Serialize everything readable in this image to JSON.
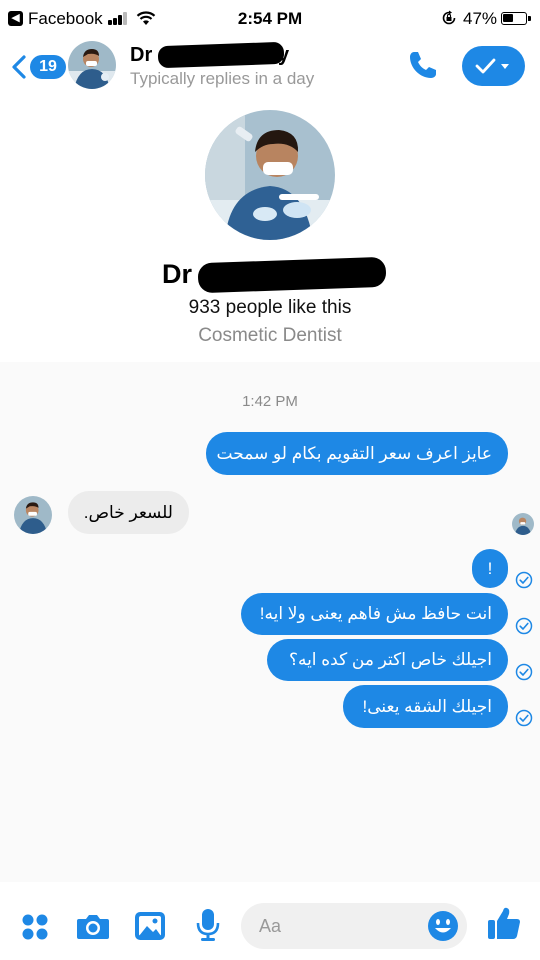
{
  "status_bar": {
    "back_app_label": "Facebook",
    "time": "2:54 PM",
    "battery_percent": "47%",
    "icons": [
      "signal-icon",
      "wifi-icon",
      "rotation-lock-icon",
      "battery-icon"
    ]
  },
  "header": {
    "back_count": "19",
    "title_visible": "Dr",
    "title_tail_visible": "y",
    "subtitle": "Typically replies in a day",
    "icons": [
      "chevron-left-icon",
      "phone-icon",
      "check-icon",
      "caret-down-icon"
    ]
  },
  "profile": {
    "name_visible": "Dr",
    "likes": "933 people like this",
    "category": "Cosmetic Dentist"
  },
  "thread": {
    "timestamp": "1:42 PM",
    "messages": [
      {
        "direction": "outgoing",
        "text": "عايز اعرف سعر التقويم بكام لو سمحت"
      },
      {
        "direction": "incoming",
        "text": "للسعر خاص."
      },
      {
        "direction": "outgoing",
        "text": "!"
      },
      {
        "direction": "outgoing",
        "text": "انت حافظ مش فاهم يعنى ولا ايه!"
      },
      {
        "direction": "outgoing",
        "text": "اجيلك خاص اكتر من كده ايه؟"
      },
      {
        "direction": "outgoing",
        "text": "اجيلك الشقه يعنى!"
      }
    ]
  },
  "composer": {
    "placeholder": "Aa",
    "icons": [
      "apps-grid-icon",
      "camera-icon",
      "gallery-icon",
      "microphone-icon",
      "emoji-icon",
      "thumbs-up-icon"
    ]
  },
  "colors": {
    "accent": "#1e88e5",
    "incoming_bubble": "#ececec",
    "muted_text": "#8a8a8a"
  }
}
